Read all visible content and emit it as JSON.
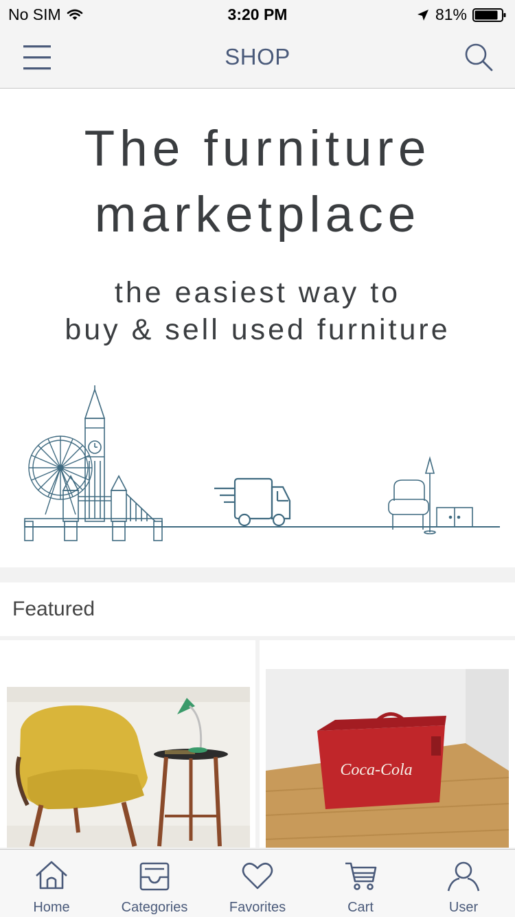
{
  "status_bar": {
    "carrier": "No SIM",
    "time": "3:20 PM",
    "battery": "81%"
  },
  "nav": {
    "title": "SHOP",
    "menu_icon": "hamburger-menu-icon",
    "search_icon": "search-icon"
  },
  "hero": {
    "title_line1": "The furniture",
    "title_line2": "marketplace",
    "subtitle_line1": "the easiest way to",
    "subtitle_line2": "buy & sell used furniture",
    "illustration": "london-skyline-delivery-truck-furniture-illustration"
  },
  "featured": {
    "label": "Featured",
    "items": [
      {
        "image": "yellow-armchair-and-side-table-photo"
      },
      {
        "image": "red-coca-cola-cooler-chest-photo",
        "brand_text": "Coca-Cola"
      }
    ]
  },
  "tabs": [
    {
      "label": "Home",
      "icon": "home-icon"
    },
    {
      "label": "Categories",
      "icon": "categories-tray-icon"
    },
    {
      "label": "Favorites",
      "icon": "heart-icon"
    },
    {
      "label": "Cart",
      "icon": "cart-icon"
    },
    {
      "label": "User",
      "icon": "user-icon"
    }
  ],
  "colors": {
    "accent": "#4a5a7a",
    "illustration": "#3f6a80",
    "text_dark": "#3a3d40"
  }
}
